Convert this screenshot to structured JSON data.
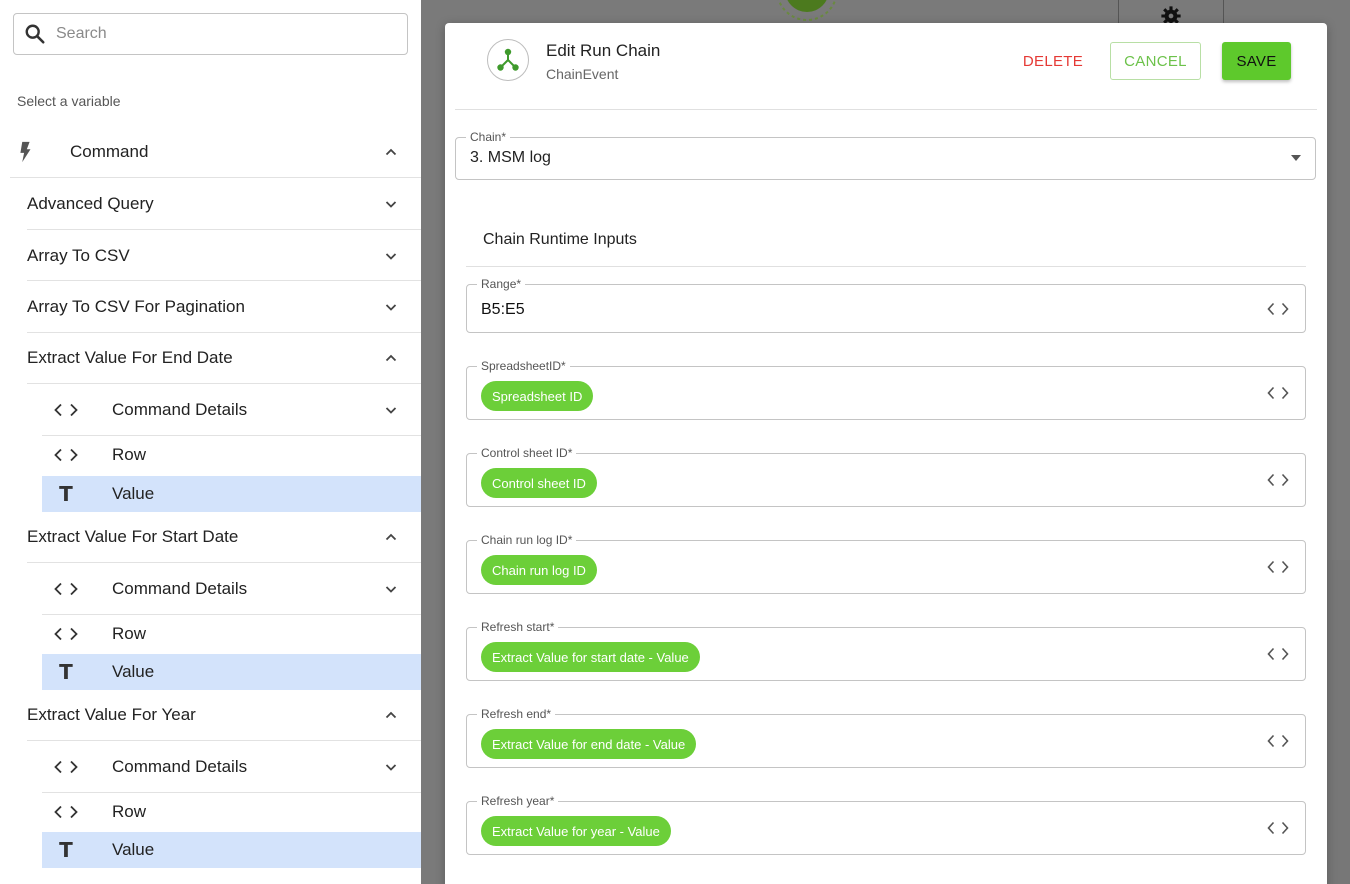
{
  "sidebar": {
    "search_placeholder": "Search",
    "select_label": "Select a variable",
    "command_label": "Command",
    "groups": [
      {
        "label": "Advanced Query"
      },
      {
        "label": "Array To CSV"
      },
      {
        "label": "Array To CSV For Pagination"
      },
      {
        "label": "Extract Value For End Date",
        "children": [
          {
            "label": "Command Details",
            "icon": "code-icon"
          },
          {
            "label": "Row",
            "icon": "code-icon"
          },
          {
            "label": "Value",
            "icon": "text-type-icon",
            "selected": true
          }
        ]
      },
      {
        "label": "Extract Value For Start Date",
        "children": [
          {
            "label": "Command Details",
            "icon": "code-icon"
          },
          {
            "label": "Row",
            "icon": "code-icon"
          },
          {
            "label": "Value",
            "icon": "text-type-icon",
            "selected": true
          }
        ]
      },
      {
        "label": "Extract Value For Year",
        "children": [
          {
            "label": "Command Details",
            "icon": "code-icon"
          },
          {
            "label": "Row",
            "icon": "code-icon"
          },
          {
            "label": "Value",
            "icon": "text-type-icon",
            "selected": true
          }
        ]
      }
    ],
    "selected_color": "#d3e3fb"
  },
  "modal": {
    "title": "Edit Run Chain",
    "subtitle": "ChainEvent",
    "delete_label": "DELETE",
    "cancel_label": "CANCEL",
    "save_label": "SAVE",
    "chain_label": "Chain*",
    "chain_value": "3. MSM log",
    "section_title": "Chain Runtime Inputs",
    "inputs": [
      {
        "label": "Range*",
        "value": "B5:E5"
      },
      {
        "label": "SpreadsheetID*",
        "chip": "Spreadsheet ID"
      },
      {
        "label": "Control sheet ID*",
        "chip": "Control sheet ID"
      },
      {
        "label": "Chain run log ID*",
        "chip": "Chain run log ID"
      },
      {
        "label": "Refresh start*",
        "chip": "Extract Value for start date - Value"
      },
      {
        "label": "Refresh end*",
        "chip": "Extract Value for end date - Value"
      },
      {
        "label": "Refresh year*",
        "chip": "Extract Value for year - Value"
      }
    ],
    "colors": {
      "accent_green": "#5ec92c",
      "chip_green": "#6ccf39",
      "delete_red": "#e53935"
    }
  }
}
